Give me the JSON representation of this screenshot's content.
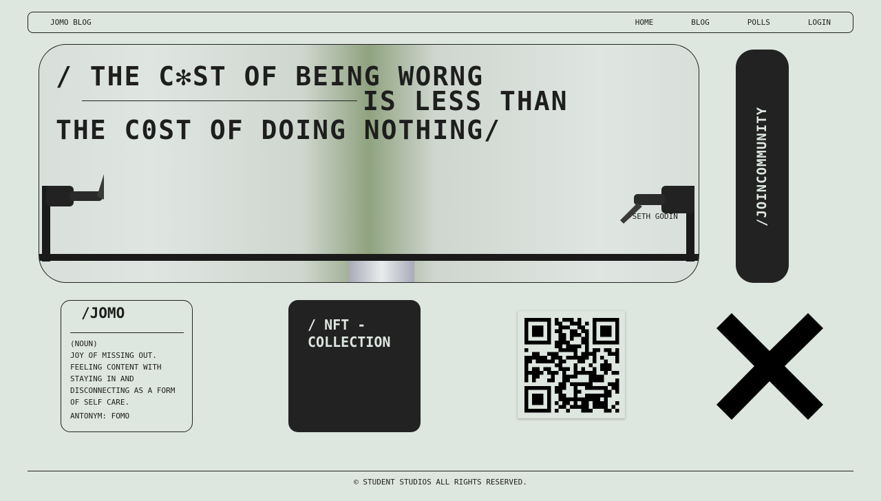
{
  "nav": {
    "brand": "JOMO BLOG",
    "links": [
      "HOME",
      "BLOG",
      "POLLS",
      "LOGIN"
    ]
  },
  "hero": {
    "line1": "/ THE C✻ST OF BEING WORNG",
    "line2": "IS LESS THAN",
    "line3": "THE C0ST OF DOING NOTHING/",
    "author": "-SETH GODIN"
  },
  "join": {
    "label": "/JOINCOMMUNITY"
  },
  "jomo": {
    "title": "/JOMO",
    "body": "(NOUN)\n JOY OF MISSING OUT.\nFEELING CONTENT WITH\nSTAYING IN AND\nDISCONNECTING AS A FORM\nOF SELF CARE.",
    "antonym": "ANTONYM: FOMO"
  },
  "nft": {
    "label": "/ NFT -\nCOLLECTION"
  },
  "icons": {
    "qr": "qr-code",
    "close": "x-mark"
  },
  "footer": {
    "text": "© STUDENT STUDIOS ALL RIGHTS RESERVED."
  }
}
